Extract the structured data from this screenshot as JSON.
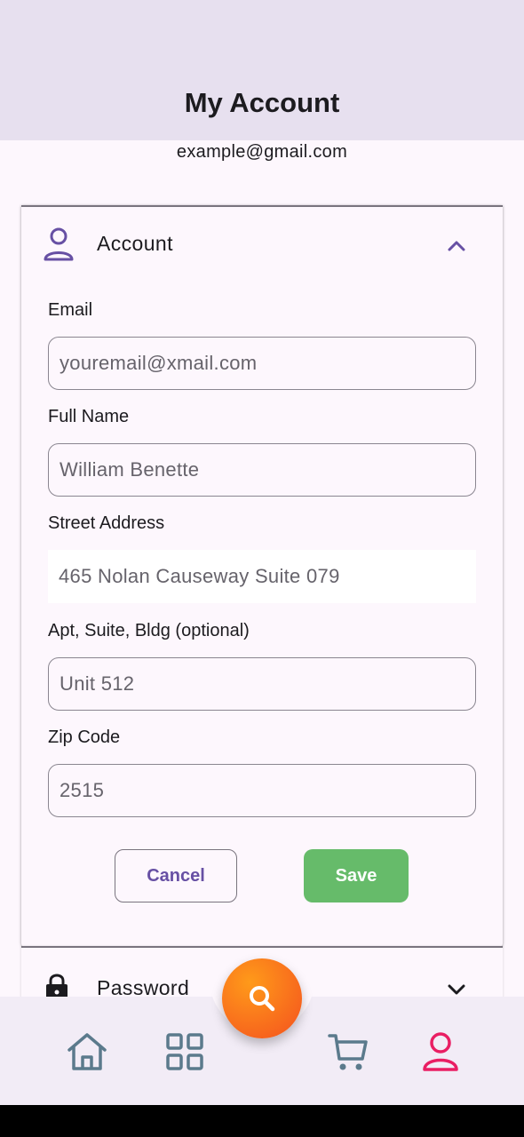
{
  "header": {
    "title": "My Account"
  },
  "user": {
    "email": "example@gmail.com"
  },
  "account_section": {
    "label": "Account",
    "icon": "person-icon",
    "expanded": true,
    "fields": [
      {
        "label": "Email",
        "value": "youremail@xmail.com"
      },
      {
        "label": "Full Name",
        "value": "William Benette"
      },
      {
        "label": "Street Address",
        "value": "465 Nolan Causeway Suite 079"
      },
      {
        "label": "Apt, Suite, Bldg (optional)",
        "value": "Unit 512"
      },
      {
        "label": "Zip Code",
        "value": "2515"
      }
    ],
    "cancel_label": "Cancel",
    "save_label": "Save"
  },
  "password_section": {
    "label": "Password",
    "icon": "lock-icon",
    "expanded": false
  },
  "bottom_nav": {
    "items": [
      {
        "name": "home",
        "icon": "home-icon"
      },
      {
        "name": "categories",
        "icon": "grid-icon"
      },
      {
        "name": "search",
        "icon": "search-icon"
      },
      {
        "name": "cart",
        "icon": "cart-icon"
      },
      {
        "name": "profile",
        "icon": "person-icon",
        "active": true
      }
    ]
  },
  "colors": {
    "app_bar": "#e7e0ef",
    "accent": "#6750a4",
    "save": "#66bb6a",
    "fab": "#f4511e",
    "nav_icon": "#5b7a8c",
    "nav_active": "#e91e63"
  }
}
